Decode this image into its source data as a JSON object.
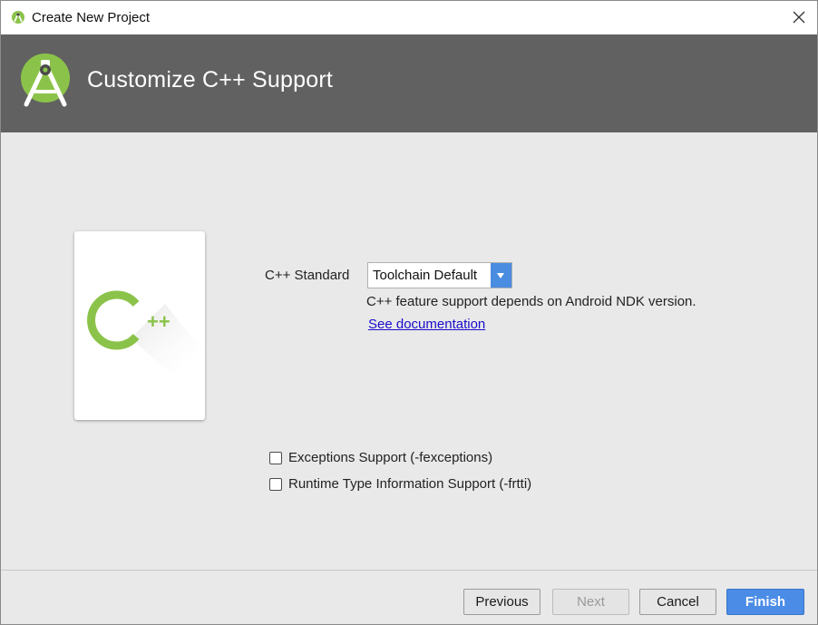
{
  "window": {
    "title": "Create New Project",
    "close_icon": "close-icon"
  },
  "header": {
    "heading": "Customize C++ Support",
    "logo": "android-studio-logo"
  },
  "card": {
    "icon": "cpp-icon",
    "glyph_c": "C",
    "glyph_pp": "++"
  },
  "form": {
    "standard_label": "C++ Standard",
    "standard_value": "Toolchain Default",
    "hint": "C++ feature support depends on Android NDK version.",
    "doc_link": "See documentation",
    "options": [
      {
        "label": "Exceptions Support (-fexceptions)",
        "checked": false
      },
      {
        "label": "Runtime Type Information Support (-frtti)",
        "checked": false
      }
    ]
  },
  "footer": {
    "previous": "Previous",
    "next": "Next",
    "cancel": "Cancel",
    "finish": "Finish"
  },
  "colors": {
    "header_bg": "#616161",
    "accent": "#4a8ce6",
    "android_green": "#8bc34a",
    "link": "#1a0dcc"
  }
}
